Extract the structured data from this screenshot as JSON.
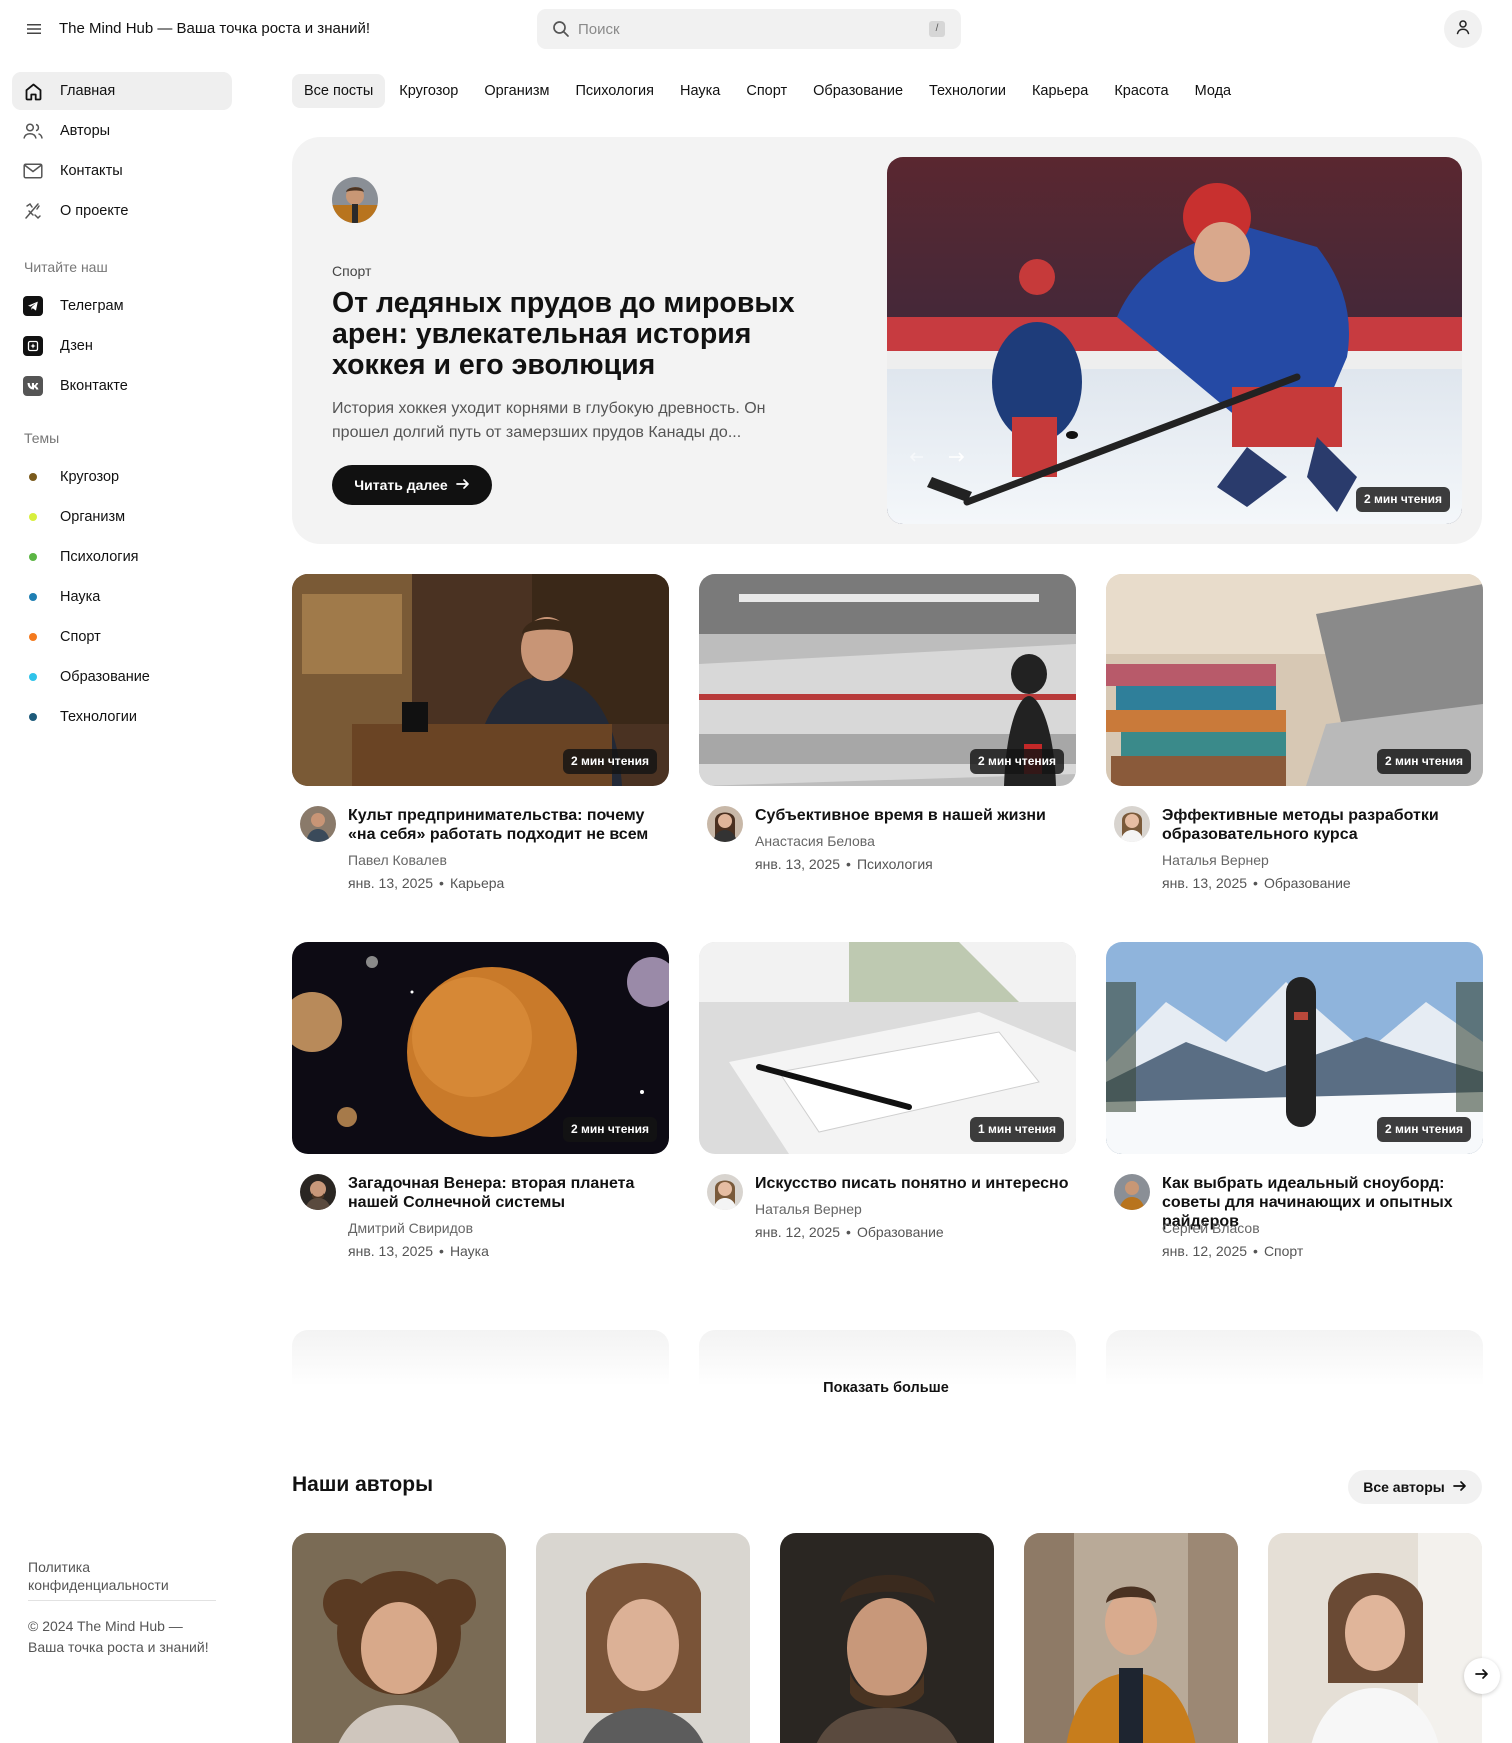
{
  "header": {
    "site_title": "The Mind Hub — Ваша точка роста и знаний!",
    "search_placeholder": "Поиск",
    "search_shortcut": "/"
  },
  "sidebar": {
    "nav": [
      {
        "label": "Главная",
        "icon": "home-icon",
        "active": true
      },
      {
        "label": "Авторы",
        "icon": "users-icon",
        "active": false
      },
      {
        "label": "Контакты",
        "icon": "mail-icon",
        "active": false
      },
      {
        "label": "О проекте",
        "icon": "info-icon",
        "active": false
      }
    ],
    "read_heading": "Читайте наш",
    "social": [
      {
        "label": "Телеграм",
        "icon": "telegram-icon"
      },
      {
        "label": "Дзен",
        "icon": "dzen-icon"
      },
      {
        "label": "Вконтакте",
        "icon": "vk-icon"
      }
    ],
    "topics_heading": "Темы",
    "topics": [
      {
        "label": "Кругозор",
        "color": "#7a5a1c"
      },
      {
        "label": "Организм",
        "color": "#d8ef3d"
      },
      {
        "label": "Психология",
        "color": "#5bb544"
      },
      {
        "label": "Наука",
        "color": "#1f7fb3"
      },
      {
        "label": "Спорт",
        "color": "#f47a1e"
      },
      {
        "label": "Образование",
        "color": "#2fc3ea"
      },
      {
        "label": "Технологии",
        "color": "#1d5a7a"
      }
    ],
    "privacy": "Политика конфиденциальности",
    "copyright": "© 2024 The Mind Hub — Ваша точка роста и знаний!"
  },
  "tabs": [
    "Все посты",
    "Кругозор",
    "Организм",
    "Психология",
    "Наука",
    "Спорт",
    "Образование",
    "Технологии",
    "Карьера",
    "Красота",
    "Мода"
  ],
  "hero": {
    "category": "Спорт",
    "title": "От ледяных прудов до мировых арен: увлекательная история хоккея и его эволюция",
    "excerpt": "История хоккея уходит корнями в глубокую древность. Он прошел долгий путь от замерзших прудов Канады до...",
    "button": "Читать далее",
    "read_time": "2 мин чтения"
  },
  "posts": [
    {
      "title": "Культ предпринимательства: почему «на себя» работать подходит не всем",
      "author": "Павел Ковалев",
      "date": "янв. 13, 2025",
      "category": "Карьера",
      "read_time": "2 мин чтения"
    },
    {
      "title": "Субъективное время в нашей жизни",
      "author": "Анастасия Белова",
      "date": "янв. 13, 2025",
      "category": "Психология",
      "read_time": "2 мин чтения"
    },
    {
      "title": "Эффективные методы разработки образовательного курса",
      "author": "Наталья Вернер",
      "date": "янв. 13, 2025",
      "category": "Образование",
      "read_time": "2 мин чтения"
    },
    {
      "title": "Загадочная Венера: вторая планета нашей Солнечной системы",
      "author": "Дмитрий Свиридов",
      "date": "янв. 13, 2025",
      "category": "Наука",
      "read_time": "2 мин чтения"
    },
    {
      "title": "Искусство писать понятно и интересно",
      "author": "Наталья Вернер",
      "date": "янв. 12, 2025",
      "category": "Образование",
      "read_time": "1 мин чтения"
    },
    {
      "title": "Как выбрать идеальный сноуборд: советы для начинающих и опытных райдеров",
      "author": "Сергей Власов",
      "date": "янв. 12, 2025",
      "category": "Спорт",
      "read_time": "2 мин чтения"
    }
  ],
  "separator": "•",
  "show_more": "Показать больше",
  "authors_section": {
    "title": "Наши авторы",
    "all_button": "Все авторы"
  }
}
